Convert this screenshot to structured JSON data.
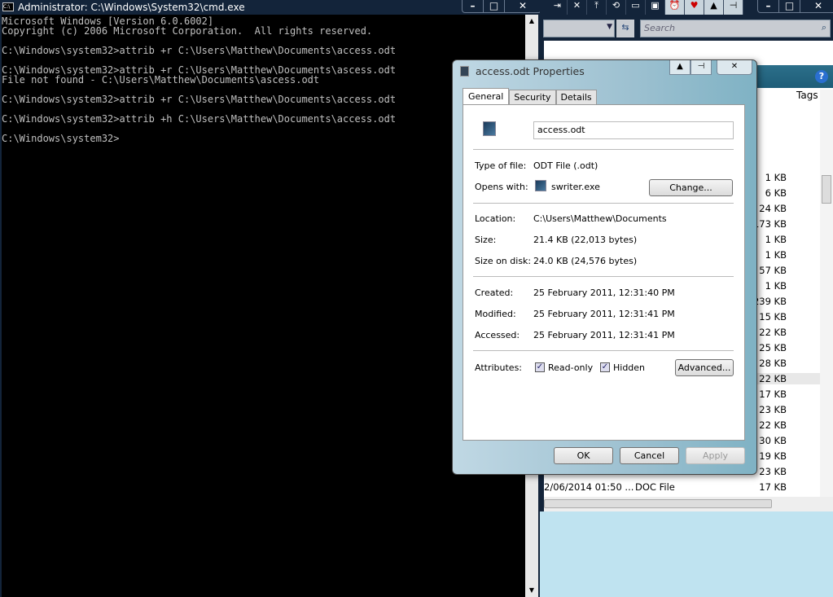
{
  "cmd": {
    "title": "Administrator: C:\\Windows\\System32\\cmd.exe",
    "icon": "C:\\",
    "lines": [
      "Microsoft Windows [Version 6.0.6002]",
      "Copyright (c) 2006 Microsoft Corporation.  All rights reserved.",
      "",
      "C:\\Windows\\system32>attrib +r C:\\Users\\Matthew\\Documents\\access.odt",
      "",
      "C:\\Windows\\system32>attrib +r C:\\Users\\Matthew\\Documents\\ascess.odt",
      "File not found - C:\\Users\\Matthew\\Documents\\ascess.odt",
      "",
      "C:\\Windows\\system32>attrib +r C:\\Users\\Matthew\\Documents\\access.odt",
      "",
      "C:\\Windows\\system32>attrib +h C:\\Users\\Matthew\\Documents\\access.odt",
      "",
      "C:\\Windows\\system32>"
    ]
  },
  "explorer": {
    "search_placeholder": "Search",
    "column_tags": "Tags",
    "sizes": [
      "1 KB",
      "6 KB",
      "24 KB",
      "173 KB",
      "1 KB",
      "1 KB",
      "57 KB",
      "1 KB",
      "239 KB",
      "15 KB",
      "22 KB",
      "25 KB",
      "28 KB",
      "22 KB",
      "17 KB",
      "23 KB",
      "22 KB",
      "30 KB",
      "19 KB",
      "23 KB",
      "17 KB"
    ],
    "last_row": {
      "date": "2/06/2014 01:50 ...",
      "type": "DOC File"
    }
  },
  "dialog": {
    "title": "access.odt Properties",
    "tabs": [
      "General",
      "Security",
      "Details"
    ],
    "filename": "access.odt",
    "type_label": "Type of file:",
    "type_value": "ODT File (.odt)",
    "opens_label": "Opens with:",
    "opens_value": "swriter.exe",
    "change": "Change...",
    "location_label": "Location:",
    "location_value": "C:\\Users\\Matthew\\Documents",
    "size_label": "Size:",
    "size_value": "21.4 KB (22,013 bytes)",
    "disk_label": "Size on disk:",
    "disk_value": "24.0 KB (24,576 bytes)",
    "created_label": "Created:",
    "created_value": "25 February 2011, 12:31:40 PM",
    "modified_label": "Modified:",
    "modified_value": "25 February 2011, 12:31:41 PM",
    "accessed_label": "Accessed:",
    "accessed_value": "25 February 2011, 12:31:41 PM",
    "attr_label": "Attributes:",
    "readonly": "Read-only",
    "hidden": "Hidden",
    "advanced": "Advanced...",
    "ok": "OK",
    "cancel": "Cancel",
    "apply": "Apply"
  }
}
